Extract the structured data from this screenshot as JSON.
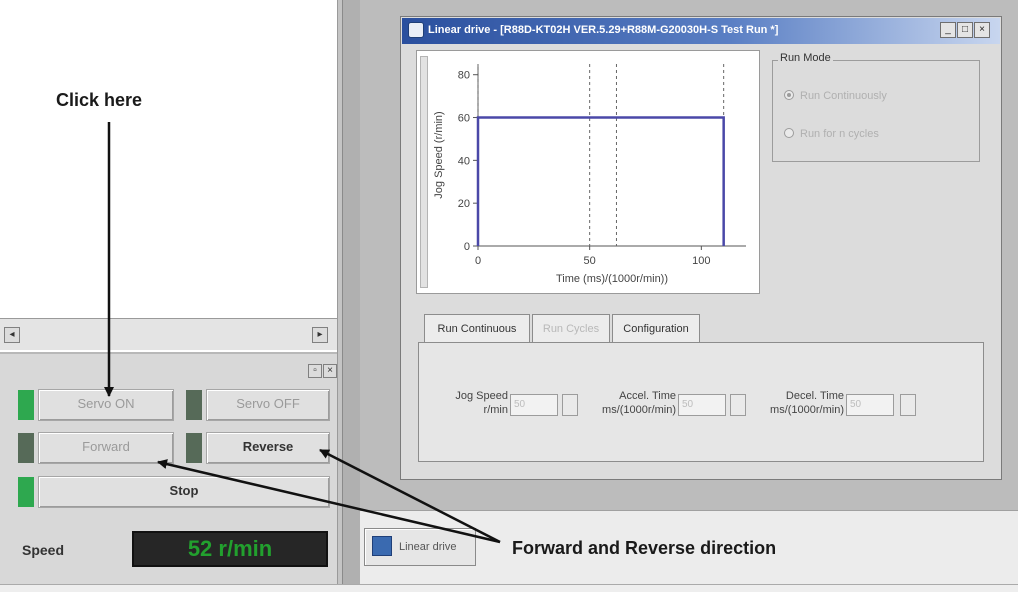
{
  "annotations": {
    "click_here": "Click here",
    "direction": "Forward and Reverse direction"
  },
  "window": {
    "title": "Linear drive - [R88D-KT02H VER.5.29+R88M-G20030H-S Test Run *]",
    "controls": {
      "minimize": "_",
      "maximize": "□",
      "close": "×"
    }
  },
  "chart_data": {
    "type": "line",
    "xlabel": "Time (ms)/(1000r/min))",
    "ylabel": "Jog Speed (r/min)",
    "x_ticks": [
      "0",
      "50",
      "100"
    ],
    "y_ticks": [
      "0",
      "20",
      "40",
      "60",
      "80"
    ],
    "xlim": [
      0,
      120
    ],
    "ylim": [
      0,
      85
    ],
    "series": [
      {
        "x": [
          0,
          0,
          110,
          110
        ],
        "y": [
          0,
          60,
          60,
          0
        ]
      }
    ],
    "dashed_markers_x": [
      0,
      50,
      62,
      110
    ]
  },
  "run_mode": {
    "label": "Run Mode",
    "options": [
      {
        "label": "Run Continuously",
        "selected": true
      },
      {
        "label": "Run for n cycles",
        "selected": false
      }
    ]
  },
  "tabs": [
    "Run Continuous",
    "Run Cycles",
    "Configuration"
  ],
  "params": {
    "jog_speed": {
      "label": "Jog Speed",
      "unit": "r/min",
      "value": "50"
    },
    "accel_time": {
      "label": "Accel. Time",
      "unit": "ms/(1000r/min)",
      "value": "50"
    },
    "decel_time": {
      "label": "Decel. Time",
      "unit": "ms/(1000r/min)",
      "value": "50"
    }
  },
  "controls": {
    "servo_on": "Servo ON",
    "servo_off": "Servo OFF",
    "forward": "Forward",
    "reverse": "Reverse",
    "stop": "Stop",
    "speed_label": "Speed",
    "speed_value": "52 r/min"
  },
  "taskbar": {
    "item": "Linear drive"
  },
  "scrollbar": {
    "left": "◂",
    "right": "▸"
  },
  "panel_controls": {
    "restore": "▫",
    "close": "×"
  },
  "colors": {
    "led_on": "#2ea84f",
    "led_off": "#566a58",
    "speed_text": "#22a02e",
    "series": "#4a48a8"
  }
}
